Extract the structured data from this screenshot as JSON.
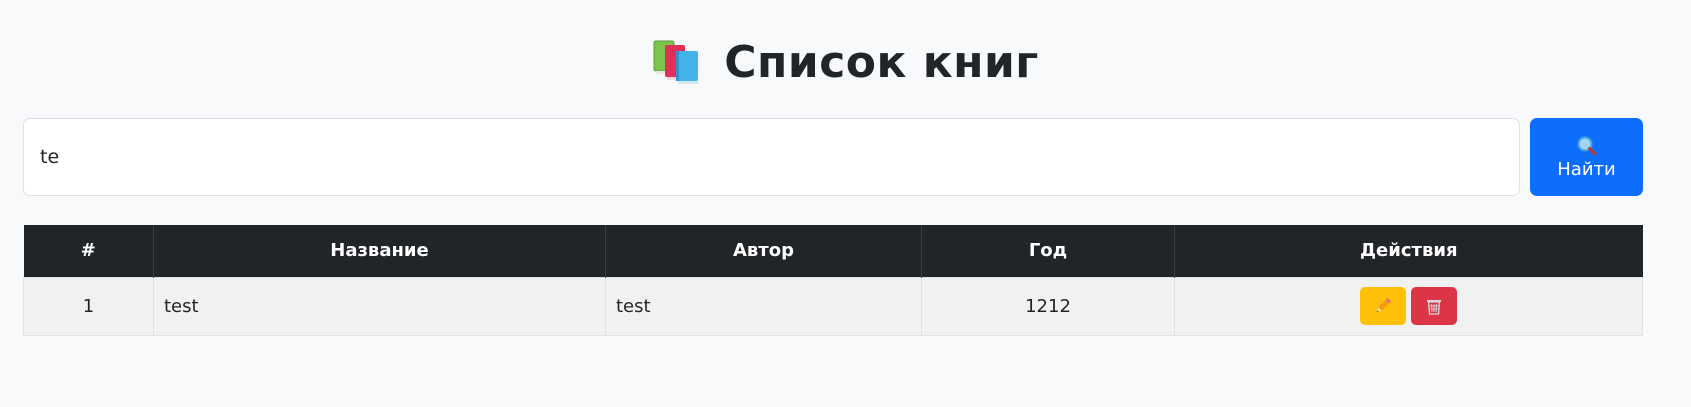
{
  "header": {
    "icon": "books-icon",
    "title": "Список книг"
  },
  "search": {
    "value": "te",
    "placeholder": "",
    "button_icon": "magnifier-icon",
    "button_label": "Найти"
  },
  "table": {
    "columns": [
      "#",
      "Название",
      "Автор",
      "Год",
      "Действия"
    ],
    "rows": [
      {
        "num": "1",
        "name": "test",
        "author": "test",
        "year": "1212",
        "actions": [
          {
            "icon": "pencil-icon",
            "color": "#ffc107"
          },
          {
            "icon": "trash-icon",
            "color": "#dc3545"
          }
        ]
      }
    ]
  },
  "colors": {
    "background": "#f8f9fa",
    "primary": "#0d6efd",
    "table_header": "#212529",
    "edit": "#ffc107",
    "delete": "#dc3545"
  }
}
